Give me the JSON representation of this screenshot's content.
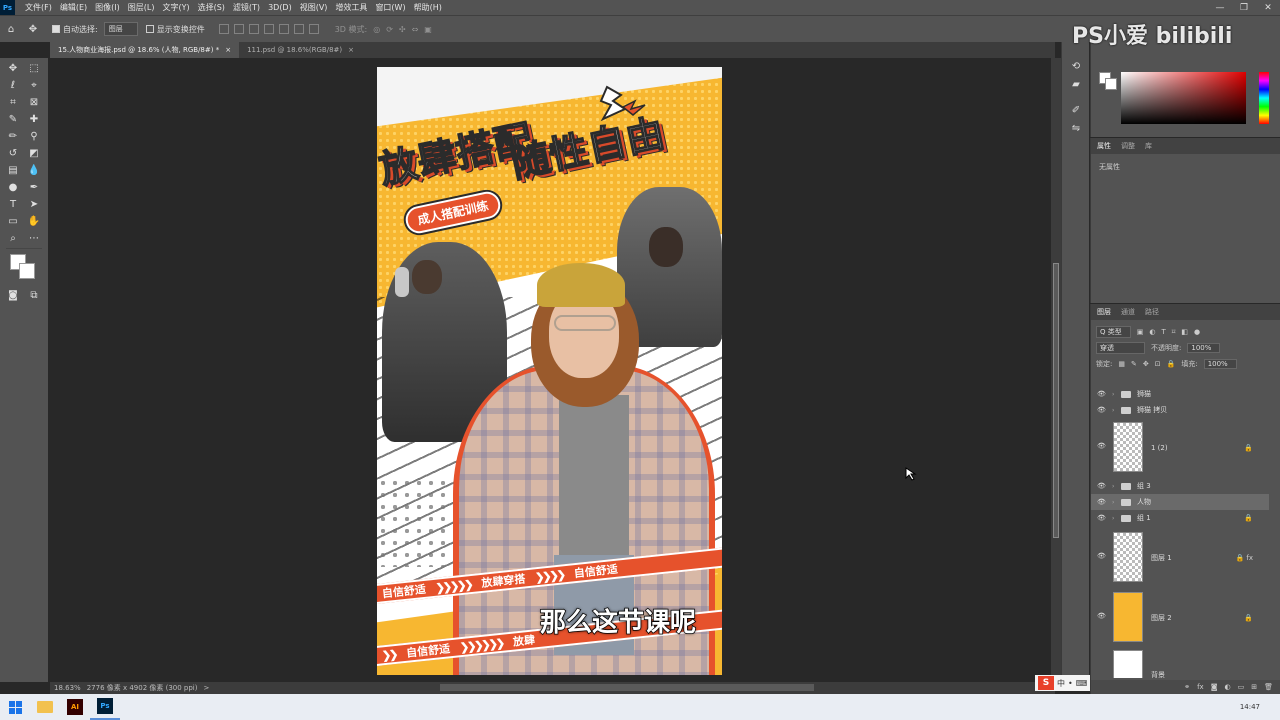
{
  "app": {
    "logo": "Ps",
    "menu": [
      "文件(F)",
      "编辑(E)",
      "图像(I)",
      "图层(L)",
      "文字(Y)",
      "选择(S)",
      "滤镜(T)",
      "3D(D)",
      "视图(V)",
      "增效工具",
      "窗口(W)",
      "帮助(H)"
    ],
    "window_controls": [
      "—",
      "❐",
      "✕"
    ]
  },
  "options_bar": {
    "auto_select_label": "自动选择:",
    "auto_select_target": "图层",
    "show_transform_label": "显示变换控件",
    "mode_3d_label": "3D 模式:"
  },
  "tabs": [
    {
      "label": "15.人物商业海报.psd @ 18.6% (人物, RGB/8#) *",
      "close": "×"
    },
    {
      "label": "111.psd @ 18.6%(RGB/8#)",
      "close": "×"
    }
  ],
  "status": {
    "zoom": "18.63%",
    "doc_info": "2776 像素 x 4902 像素 (300 ppi)",
    "arrow": ">"
  },
  "poster": {
    "title_left": "放肆搭配",
    "title_right": "随性自由",
    "subtitle": "成人搭配训练",
    "stripe1": [
      "自信舒适",
      "放肆穿搭",
      "自信舒适"
    ],
    "stripe2": [
      "自信舒适",
      "放肆"
    ]
  },
  "caption": "那么这节课呢",
  "watermark": "PS小爱 bilibili",
  "properties_panel": {
    "tabs": [
      "属性",
      "调整",
      "库"
    ],
    "empty_text": "无属性"
  },
  "layers_panel": {
    "tabs": [
      "图层",
      "通道",
      "路径"
    ],
    "filter_label": "Q 类型",
    "blend_mode": "穿透",
    "opacity_label": "不透明度:",
    "opacity_value": "100%",
    "lock_label": "锁定:",
    "fill_label": "填充:",
    "fill_value": "100%",
    "layers": [
      {
        "name": "狮猫",
        "type": "group"
      },
      {
        "name": "狮猫 拷贝",
        "type": "group"
      },
      {
        "name": "1 (2)",
        "type": "smart"
      },
      {
        "name": "组 3",
        "type": "group"
      },
      {
        "name": "人物",
        "type": "group",
        "selected": true
      },
      {
        "name": "组 1",
        "type": "group"
      },
      {
        "name": "图层 1",
        "type": "pixel"
      },
      {
        "name": "图层 2",
        "type": "fill"
      },
      {
        "name": "背景",
        "type": "background"
      }
    ]
  },
  "ime": {
    "logo": "S",
    "lang": "中"
  },
  "taskbar": {
    "apps": [
      "AI",
      "Ps"
    ],
    "time": "14:47"
  },
  "colors": {
    "accent_orange": "#e6522c",
    "poster_yellow": "#f7b731",
    "ui_panel": "#535353"
  }
}
